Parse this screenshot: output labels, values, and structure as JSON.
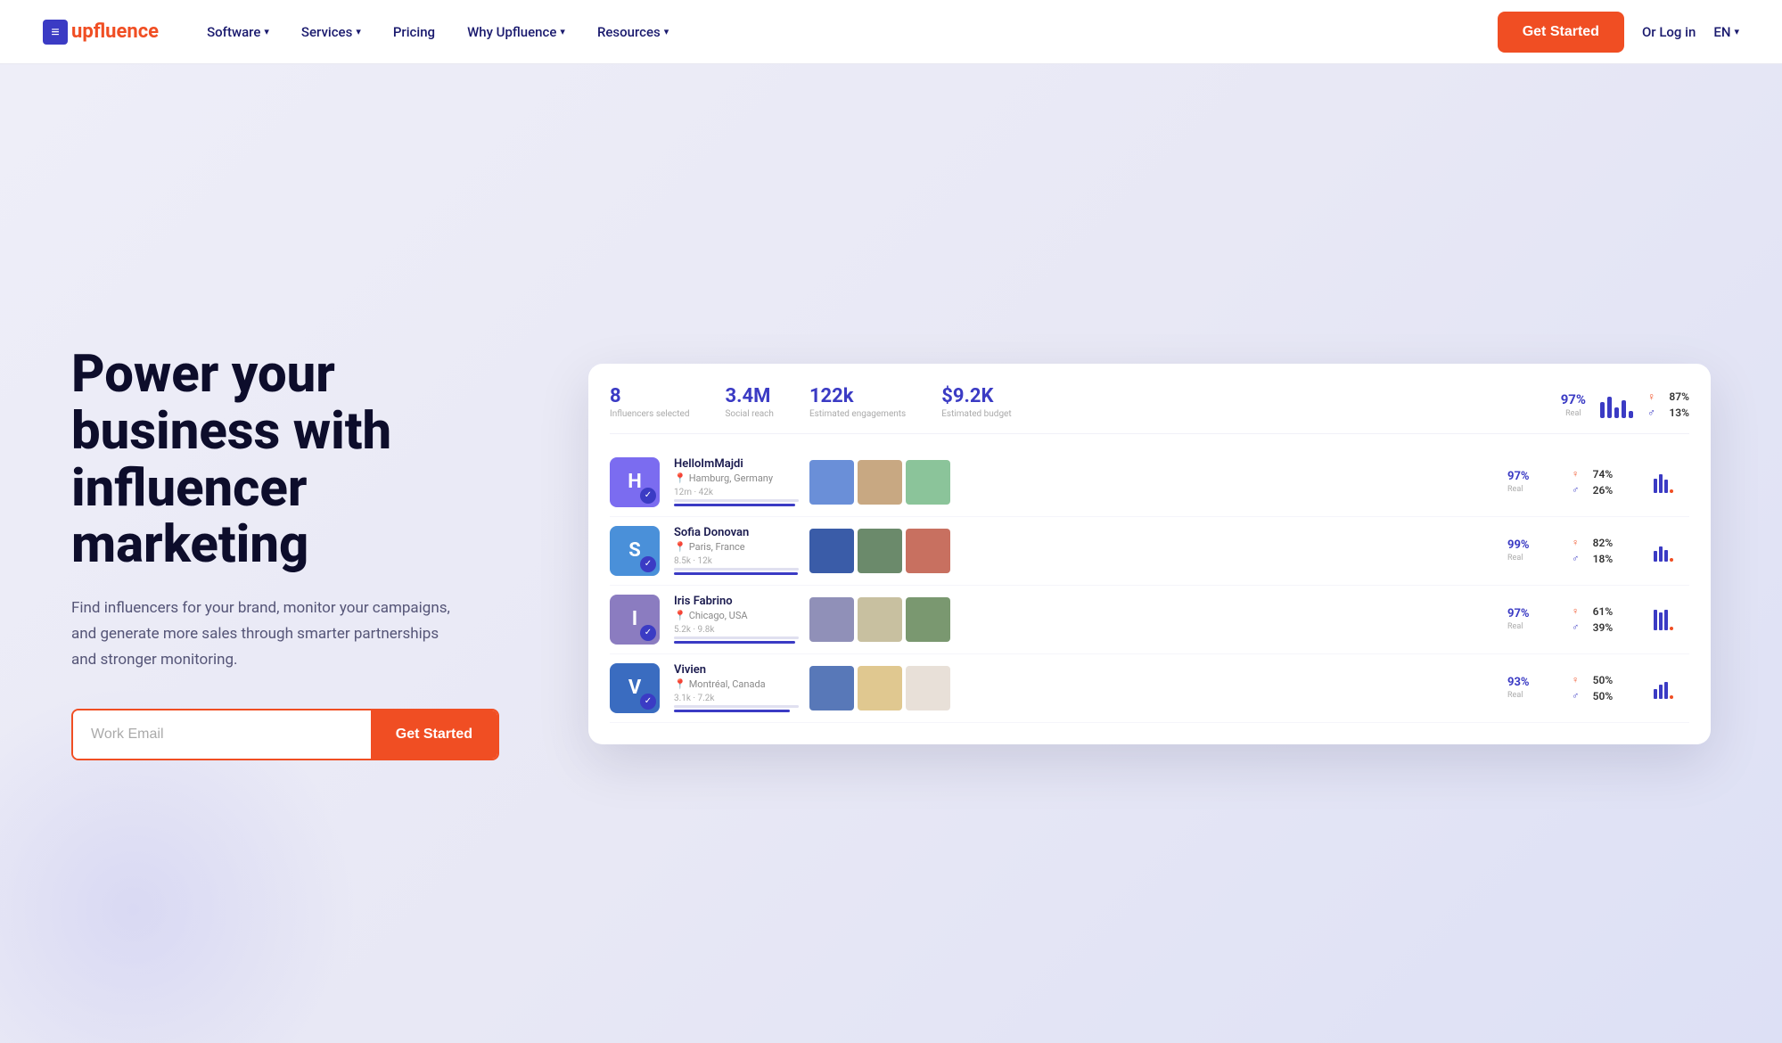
{
  "nav": {
    "logo_text_up": "up",
    "logo_text_fluence": "fluence",
    "items": [
      {
        "label": "Software",
        "has_dropdown": true
      },
      {
        "label": "Services",
        "has_dropdown": true
      },
      {
        "label": "Pricing",
        "has_dropdown": false
      },
      {
        "label": "Why Upfluence",
        "has_dropdown": true
      },
      {
        "label": "Resources",
        "has_dropdown": true
      }
    ],
    "cta_label": "Get Started",
    "login_label": "Or Log in",
    "lang_label": "EN"
  },
  "hero": {
    "title": "Power your business with influencer marketing",
    "subtitle": "Find influencers for your brand, monitor your campaigns, and generate more sales through smarter partnerships and stronger monitoring.",
    "email_placeholder": "Work Email",
    "cta_label": "Get Started"
  },
  "dashboard": {
    "stats": [
      {
        "value": "8",
        "label": "Influencers selected"
      },
      {
        "value": "3.4M",
        "label": "Social reach"
      },
      {
        "value": "122k",
        "label": "Estimated engagements"
      },
      {
        "value": "$9.2K",
        "label": "Estimated budget"
      }
    ],
    "top_stats": {
      "real_pct": "97%",
      "real_label": "Real",
      "female_pct": "87%",
      "male_pct": "13%"
    },
    "influencers": [
      {
        "name": "HelloImMajdi",
        "location": "Hamburg, Germany",
        "stats": "12m · 42k",
        "match": "97%",
        "match_label": "Real",
        "female_pct": "74%",
        "male_pct": "26%",
        "avatar_color": "#7b6cf0",
        "avatar_initial": "H",
        "photos": [
          "#6a8fd8",
          "#c8a882",
          "#8bc49a"
        ]
      },
      {
        "name": "Sofia Donovan",
        "location": "Paris, France",
        "stats": "8.5k · 12k",
        "match": "99%",
        "match_label": "Real",
        "female_pct": "82%",
        "male_pct": "18%",
        "avatar_color": "#4a90d9",
        "avatar_initial": "S",
        "photos": [
          "#3a5ca8",
          "#6b8a6b",
          "#c87060"
        ]
      },
      {
        "name": "Iris Fabrino",
        "location": "Chicago, USA",
        "stats": "5.2k · 9.8k",
        "match": "97%",
        "match_label": "Real",
        "female_pct": "61%",
        "male_pct": "39%",
        "avatar_color": "#8b7cc0",
        "avatar_initial": "I",
        "photos": [
          "#9090b8",
          "#c8c0a0",
          "#7a9870"
        ]
      },
      {
        "name": "Vivien",
        "location": "Montréal, Canada",
        "stats": "3.1k · 7.2k",
        "match": "93%",
        "match_label": "Real",
        "female_pct": "50%",
        "male_pct": "50%",
        "avatar_color": "#3a6cc0",
        "avatar_initial": "V",
        "photos": [
          "#5878b8",
          "#e0c890",
          "#e8e0d8"
        ]
      }
    ]
  }
}
